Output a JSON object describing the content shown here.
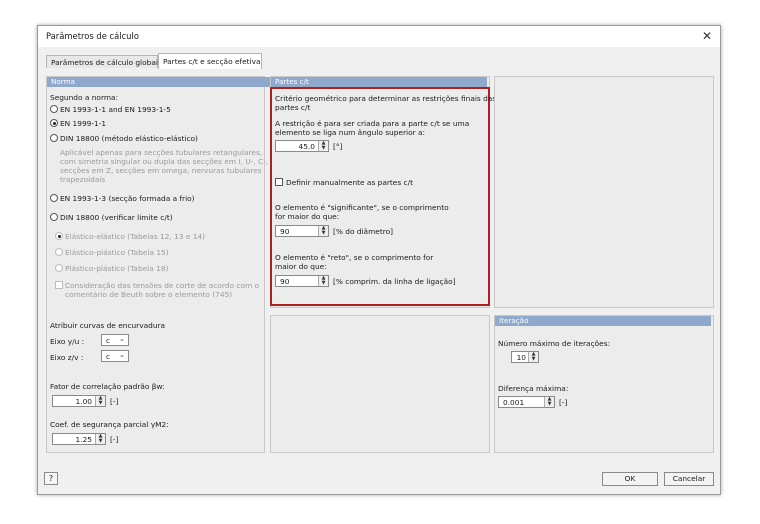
{
  "window": {
    "title": "Parâmetros de cálculo",
    "close_glyph": "✕"
  },
  "tabs": [
    {
      "label": "Parâmetros de cálculo globais"
    },
    {
      "label": "Partes c/t e secção efetiva"
    }
  ],
  "norma": {
    "header": "Norma",
    "prompt": "Segundo a norma:",
    "options": [
      "EN 1993-1-1 and EN 1993-1-5",
      "EN 1999-1-1",
      "DIN 18800 (método elástico-elástico)"
    ],
    "selected_index": 1,
    "note_lines": [
      "Aplicável apenas para secções tubulares retangulares,",
      "com simetria singular ou dupla das secções em I, U-, C-,",
      "secções em Z, secções em omega, nervuras tubulares",
      "trapezoidais"
    ],
    "option_cold": "EN 1993-1-3 (secção formada a frio)",
    "option_limit": "DIN 18800 (verificar limite c/t)",
    "sub_options": [
      "Elástico-elástico (Tabelas 12, 13 e 14)",
      "Elástico-plástico  (Tabela 15)",
      "Plástico-plástico  (Tabela 18)"
    ],
    "beuth_lines": [
      "Consideração das tensões de corte de acordo com o",
      "comentário de Beuth sobre o elemento (745)"
    ],
    "curves_label": "Atribuir curvas de encurvadura",
    "axis_y_label": "Eixo y/u :",
    "axis_y_value": "c",
    "axis_z_label": "Eixo z/v :",
    "axis_z_value": "c",
    "corr_label": "Fator de correlação padrão βw:",
    "corr_value": "1.00",
    "corr_unit": "[-]",
    "gamma_label": "Coef. de segurança parcial γM2:",
    "gamma_value": "1.25",
    "gamma_unit": "[-]"
  },
  "ct": {
    "header": "Partes c/t",
    "crit_lines": [
      "Critério geométrico para determinar as restrições finais das",
      "partes c/t"
    ],
    "angle_lines": [
      "A restrição é para ser criada para a parte c/t se uma",
      "elemento se liga num ângulo superior a:"
    ],
    "angle_value": "45.0",
    "angle_unit": "[°]",
    "manual_label": "Definir manualmente as partes c/t",
    "sig_lines": [
      "O elemento é \"significante\", se o comprimento",
      "for maior do que:"
    ],
    "sig_value": "90",
    "sig_unit": "[% do diâmetro]",
    "reto_lines": [
      "O elemento é \"reto\", se o comprimento for",
      "maior do que:"
    ],
    "reto_value": "90",
    "reto_unit": "[% comprim. da linha de ligação]"
  },
  "iteracao": {
    "header": "Iteração",
    "max_label": "Número máximo de iterações:",
    "max_value": "10",
    "diff_label": "Diferença máxima:",
    "diff_value": "0.001",
    "diff_unit": "[-]"
  },
  "footer": {
    "ok": "OK",
    "cancel": "Cancelar"
  }
}
